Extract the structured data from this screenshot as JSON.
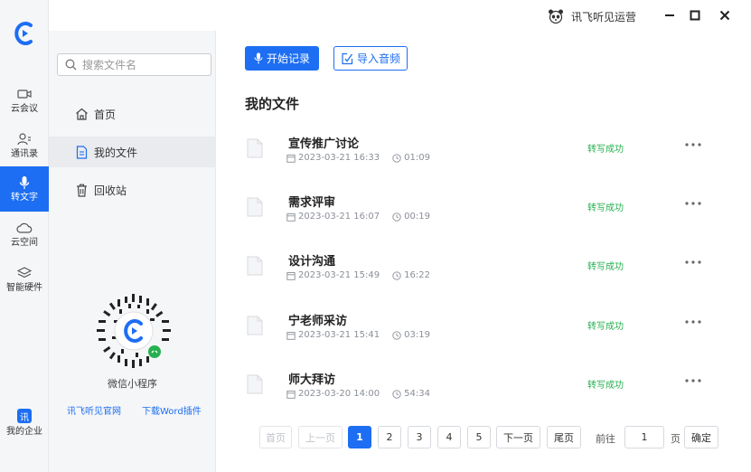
{
  "window": {
    "user_name": "讯飞听见运营",
    "controls": {
      "minimize": "minimize-icon",
      "maximize": "maximize-icon",
      "close": "close-icon"
    }
  },
  "rail": {
    "items": [
      {
        "label": "云会议",
        "icon": "video-icon"
      },
      {
        "label": "通讯录",
        "icon": "contacts-icon"
      },
      {
        "label": "转文字",
        "icon": "microphone-icon",
        "active": true
      },
      {
        "label": "云空间",
        "icon": "cloud-icon"
      },
      {
        "label": "智能硬件",
        "icon": "layers-icon"
      }
    ],
    "org": {
      "badge": "讯",
      "label": "我的企业"
    }
  },
  "sidebar": {
    "search_placeholder": "搜索文件名",
    "nav": [
      {
        "label": "首页",
        "icon": "home-icon"
      },
      {
        "label": "我的文件",
        "icon": "document-icon",
        "active": true
      },
      {
        "label": "回收站",
        "icon": "trash-icon"
      }
    ],
    "qr_caption": "微信小程序",
    "links": {
      "website": "讯飞听见官网",
      "word_plugin": "下载Word插件"
    }
  },
  "main": {
    "start_record": "开始记录",
    "import_audio": "导入音频",
    "section_title": "我的文件",
    "files": [
      {
        "name": "宣传推广讨论",
        "date": "2023-03-21 16:33",
        "duration": "01:09",
        "status": "转写成功"
      },
      {
        "name": "需求评审",
        "date": "2023-03-21 16:07",
        "duration": "00:19",
        "status": "转写成功"
      },
      {
        "name": "设计沟通",
        "date": "2023-03-21 15:49",
        "duration": "16:22",
        "status": "转写成功"
      },
      {
        "name": "宁老师采访",
        "date": "2023-03-21 15:41",
        "duration": "03:19",
        "status": "转写成功"
      },
      {
        "name": "师大拜访",
        "date": "2023-03-20 14:00",
        "duration": "54:34",
        "status": "转写成功"
      }
    ],
    "pagination": {
      "first": "首页",
      "prev": "上一页",
      "pages": [
        "1",
        "2",
        "3",
        "4",
        "5"
      ],
      "current": "1",
      "next": "下一页",
      "last": "尾页",
      "goto_label": "前往",
      "goto_value": "1",
      "page_unit": "页",
      "confirm": "确定"
    }
  },
  "colors": {
    "accent": "#1d6ef2",
    "success": "#26b050",
    "sidebar_bg": "#f5f6f8"
  }
}
